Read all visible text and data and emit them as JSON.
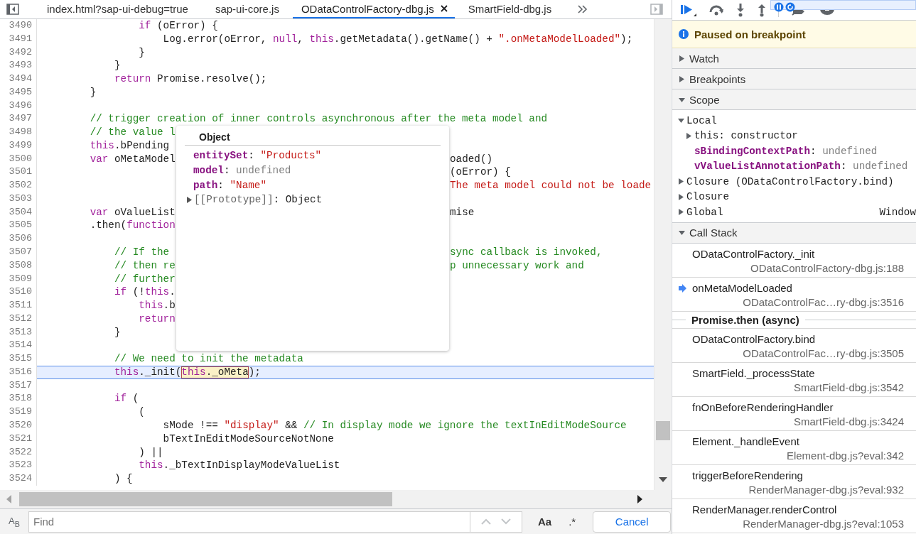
{
  "tabs": [
    {
      "label": "index.html?sap-ui-debug=true",
      "selected": false
    },
    {
      "label": "sap-ui-core.js",
      "selected": false
    },
    {
      "label": "ODataControlFactory-dbg.js",
      "selected": true
    },
    {
      "label": "SmartField-dbg.js",
      "selected": false
    }
  ],
  "code": {
    "lines": [
      {
        "number": "3490",
        "current": false,
        "segments": [
          {
            "kind": "text",
            "parts": [
              {
                "kind": "keyword",
                "text": "                if"
              },
              {
                "kind": "plain",
                "text": " (oError) {"
              }
            ]
          }
        ]
      },
      {
        "number": "3491",
        "current": false,
        "segments": [
          {
            "kind": "text",
            "parts": [
              {
                "kind": "plain",
                "text": "                    Log.error(oError, "
              },
              {
                "kind": "keyword",
                "text": "null"
              },
              {
                "kind": "plain",
                "text": ", "
              },
              {
                "kind": "keyword",
                "text": "this"
              },
              {
                "kind": "plain",
                "text": ".getMetadata().getName() + "
              },
              {
                "kind": "string",
                "text": "\".onMetaModelLoaded\""
              },
              {
                "kind": "plain",
                "text": ");"
              }
            ]
          }
        ]
      },
      {
        "number": "3492",
        "current": false,
        "segments": [
          {
            "kind": "text",
            "parts": [
              {
                "kind": "plain",
                "text": "                }"
              }
            ]
          }
        ]
      },
      {
        "number": "3493",
        "current": false,
        "segments": [
          {
            "kind": "text",
            "parts": [
              {
                "kind": "plain",
                "text": "            }"
              }
            ]
          }
        ]
      },
      {
        "number": "3494",
        "current": false,
        "segments": [
          {
            "kind": "text",
            "parts": [
              {
                "kind": "keyword",
                "text": "            return"
              },
              {
                "kind": "plain",
                "text": " Promise.resolve();"
              }
            ]
          }
        ]
      },
      {
        "number": "3495",
        "current": false,
        "segments": [
          {
            "kind": "text",
            "parts": [
              {
                "kind": "plain",
                "text": "        }"
              }
            ]
          }
        ]
      },
      {
        "number": "3496",
        "current": false
      },
      {
        "number": "3497",
        "current": false,
        "segments": [
          {
            "kind": "text",
            "parts": [
              {
                "kind": "comment",
                "text": "        // trigger creation of inner controls asynchronous after the meta model and"
              }
            ]
          }
        ]
      },
      {
        "number": "3498",
        "current": false,
        "segments": [
          {
            "kind": "text",
            "parts": [
              {
                "kind": "comment",
                "text": "        // the value l"
              }
            ]
          }
        ]
      },
      {
        "number": "3499",
        "current": false,
        "segments": [
          {
            "kind": "text",
            "parts": [
              {
                "kind": "keyword",
                "text": "        this"
              },
              {
                "kind": "plain",
                "text": ".bPending"
              }
            ]
          }
        ]
      },
      {
        "number": "3500",
        "current": false,
        "segments": [
          {
            "kind": "text",
            "parts": [
              {
                "kind": "keyword",
                "text": "        var"
              },
              {
                "kind": "plain",
                "text": " oMetaModel"
              }
            ]
          }
        ],
        "after_popup": [
          {
            "kind": "text",
            "parts": [
              {
                "kind": "plain",
                "text": "oaded()"
              }
            ]
          }
        ]
      },
      {
        "number": "3501",
        "current": false,
        "after_popup": [
          {
            "kind": "text",
            "parts": [
              {
                "kind": "plain",
                "text": "(oError) {"
              }
            ]
          }
        ]
      },
      {
        "number": "3502",
        "current": false,
        "after_popup": [
          {
            "kind": "text",
            "parts": [
              {
                "kind": "string",
                "text": "The meta model could not be loade"
              }
            ]
          }
        ]
      },
      {
        "number": "3503",
        "current": false
      },
      {
        "number": "3504",
        "current": false,
        "segments": [
          {
            "kind": "text",
            "parts": [
              {
                "kind": "keyword",
                "text": "        var"
              },
              {
                "kind": "plain",
                "text": " oValueList"
              }
            ]
          }
        ],
        "after_popup": [
          {
            "kind": "text",
            "parts": [
              {
                "kind": "plain",
                "text": "mise"
              }
            ]
          }
        ]
      },
      {
        "number": "3505",
        "current": false,
        "segments": [
          {
            "kind": "text",
            "parts": [
              {
                "kind": "plain",
                "text": "        .then("
              },
              {
                "kind": "keyword",
                "text": "function"
              }
            ]
          }
        ]
      },
      {
        "number": "3506",
        "current": false
      },
      {
        "number": "3507",
        "current": false,
        "segments": [
          {
            "kind": "text",
            "parts": [
              {
                "kind": "comment",
                "text": "            // If the"
              }
            ]
          }
        ],
        "after_popup": [
          {
            "kind": "text",
            "parts": [
              {
                "kind": "comment",
                "text": "sync callback is invoked,"
              }
            ]
          }
        ]
      },
      {
        "number": "3508",
        "current": false,
        "segments": [
          {
            "kind": "text",
            "parts": [
              {
                "kind": "comment",
                "text": "            // then re"
              }
            ]
          }
        ],
        "after_popup": [
          {
            "kind": "text",
            "parts": [
              {
                "kind": "comment",
                "text": "p unnecessary work and"
              }
            ]
          }
        ]
      },
      {
        "number": "3509",
        "current": false,
        "segments": [
          {
            "kind": "text",
            "parts": [
              {
                "kind": "comment",
                "text": "            // further"
              }
            ]
          }
        ]
      },
      {
        "number": "3510",
        "current": false,
        "segments": [
          {
            "kind": "text",
            "parts": [
              {
                "kind": "keyword",
                "text": "            if"
              },
              {
                "kind": "plain",
                "text": " (!"
              },
              {
                "kind": "keyword",
                "text": "this"
              },
              {
                "kind": "plain",
                "text": "."
              }
            ]
          }
        ]
      },
      {
        "number": "3511",
        "current": false,
        "segments": [
          {
            "kind": "text",
            "parts": [
              {
                "kind": "keyword",
                "text": "                this"
              },
              {
                "kind": "plain",
                "text": ".b"
              }
            ]
          }
        ]
      },
      {
        "number": "3512",
        "current": false,
        "segments": [
          {
            "kind": "text",
            "parts": [
              {
                "kind": "keyword",
                "text": "                return"
              }
            ]
          }
        ]
      },
      {
        "number": "3513",
        "current": false,
        "segments": [
          {
            "kind": "text",
            "parts": [
              {
                "kind": "plain",
                "text": "            }"
              }
            ]
          }
        ]
      },
      {
        "number": "3514",
        "current": false
      },
      {
        "number": "3515",
        "current": false,
        "segments": [
          {
            "kind": "text",
            "parts": [
              {
                "kind": "comment",
                "text": "            // We need to init the metadata"
              }
            ]
          }
        ]
      },
      {
        "number": "3516",
        "current": true,
        "segments": [
          {
            "kind": "text",
            "parts": [
              {
                "kind": "keyword",
                "text": "            this"
              },
              {
                "kind": "plain",
                "text": "._init("
              }
            ]
          },
          {
            "kind": "hovered",
            "parts": [
              {
                "kind": "keyword",
                "text": "this"
              },
              {
                "kind": "plain",
                "text": "._oMeta"
              }
            ]
          },
          {
            "kind": "text",
            "parts": [
              {
                "kind": "plain",
                "text": ");"
              }
            ]
          }
        ]
      },
      {
        "number": "3517",
        "current": false
      },
      {
        "number": "3518",
        "current": false,
        "segments": [
          {
            "kind": "text",
            "parts": [
              {
                "kind": "keyword",
                "text": "            if"
              },
              {
                "kind": "plain",
                "text": " ("
              }
            ]
          }
        ]
      },
      {
        "number": "3519",
        "current": false,
        "segments": [
          {
            "kind": "text",
            "parts": [
              {
                "kind": "plain",
                "text": "                ("
              }
            ]
          }
        ]
      },
      {
        "number": "3520",
        "current": false,
        "segments": [
          {
            "kind": "text",
            "parts": [
              {
                "kind": "plain",
                "text": "                    sMode !== "
              },
              {
                "kind": "string",
                "text": "\"display\""
              },
              {
                "kind": "plain",
                "text": " && "
              },
              {
                "kind": "comment",
                "text": "// In display mode we ignore the textInEditModeSource"
              }
            ]
          }
        ]
      },
      {
        "number": "3521",
        "current": false,
        "segments": [
          {
            "kind": "text",
            "parts": [
              {
                "kind": "plain",
                "text": "                    bTextInEditModeSourceNotNone"
              }
            ]
          }
        ]
      },
      {
        "number": "3522",
        "current": false,
        "segments": [
          {
            "kind": "text",
            "parts": [
              {
                "kind": "plain",
                "text": "                ) ||"
              }
            ]
          }
        ]
      },
      {
        "number": "3523",
        "current": false,
        "segments": [
          {
            "kind": "text",
            "parts": [
              {
                "kind": "keyword",
                "text": "                this"
              },
              {
                "kind": "plain",
                "text": "._bTextInDisplayModeValueList"
              }
            ]
          }
        ]
      },
      {
        "number": "3524",
        "current": false,
        "segments": [
          {
            "kind": "text",
            "parts": [
              {
                "kind": "plain",
                "text": "            ) {"
              }
            ]
          }
        ]
      }
    ]
  },
  "popup": {
    "title": "Object",
    "properties": [
      {
        "name": "entitySet",
        "separator": ":",
        "value": "\"Products\"",
        "kind": "string"
      },
      {
        "name": "model",
        "separator": ":",
        "value": "undefined",
        "kind": "undefined"
      },
      {
        "name": "path",
        "separator": ":",
        "value": "\"Name\"",
        "kind": "string"
      },
      {
        "name": "[[Prototype]]",
        "separator": ":",
        "value": "Object",
        "kind": "internal",
        "expanded": false
      }
    ]
  },
  "find": {
    "toggle": "A$_{B}$",
    "placeholder": "Find",
    "case_button": "Aa",
    "regex_button": ".*",
    "cancel": "Cancel"
  },
  "banner": {
    "text": "Paused on breakpoint"
  },
  "sections": [
    {
      "title": "Watch",
      "expanded": false
    },
    {
      "title": "Breakpoints",
      "expanded": false
    },
    {
      "title": "Scope",
      "expanded": true,
      "scopes": [
        {
          "label": "Local",
          "expanded": true,
          "children": [
            {
              "name": "this",
              "separator": ":",
              "value": "constructor",
              "kind": "object",
              "expanded": false
            },
            {
              "name": "sBindingContextPath",
              "separator": ":",
              "value": "undefined",
              "kind": "variable"
            },
            {
              "name": "vValueListAnnotationPath",
              "separator": ":",
              "value": "undefined",
              "kind": "variable"
            }
          ]
        },
        {
          "label": "Closure (ODataControlFactory.bind)",
          "expanded": false
        },
        {
          "label": "Closure",
          "expanded": false
        },
        {
          "label": "Global",
          "expanded": false,
          "value": "Window"
        }
      ]
    },
    {
      "title": "Call Stack",
      "expanded": true,
      "frames": [
        {
          "kind": "frame",
          "function": "ODataControlFactory._init",
          "location": "ODataControlFactory-dbg.js:188",
          "selected": false
        },
        {
          "kind": "frame",
          "function": "onMetaModelLoaded",
          "location": "ODataControlFac…ry-dbg.js:3516",
          "selected": true
        },
        {
          "kind": "async",
          "label": "Promise.then (async)"
        },
        {
          "kind": "frame",
          "function": "ODataControlFactory.bind",
          "location": "ODataControlFac…ry-dbg.js:3505",
          "selected": false
        },
        {
          "kind": "frame",
          "function": "SmartField._processState",
          "location": "SmartField-dbg.js:3542",
          "selected": false
        },
        {
          "kind": "frame",
          "function": "fnOnBeforeRenderingHandler",
          "location": "SmartField-dbg.js:3424",
          "selected": false
        },
        {
          "kind": "frame",
          "function": "Element._handleEvent",
          "location": "Element-dbg.js?eval:342",
          "selected": false
        },
        {
          "kind": "frame",
          "function": "triggerBeforeRendering",
          "location": "RenderManager-dbg.js?eval:932",
          "selected": false
        },
        {
          "kind": "frame",
          "function": "RenderManager.renderControl",
          "location": "RenderManager-dbg.js?eval:1053",
          "selected": false
        }
      ]
    }
  ]
}
